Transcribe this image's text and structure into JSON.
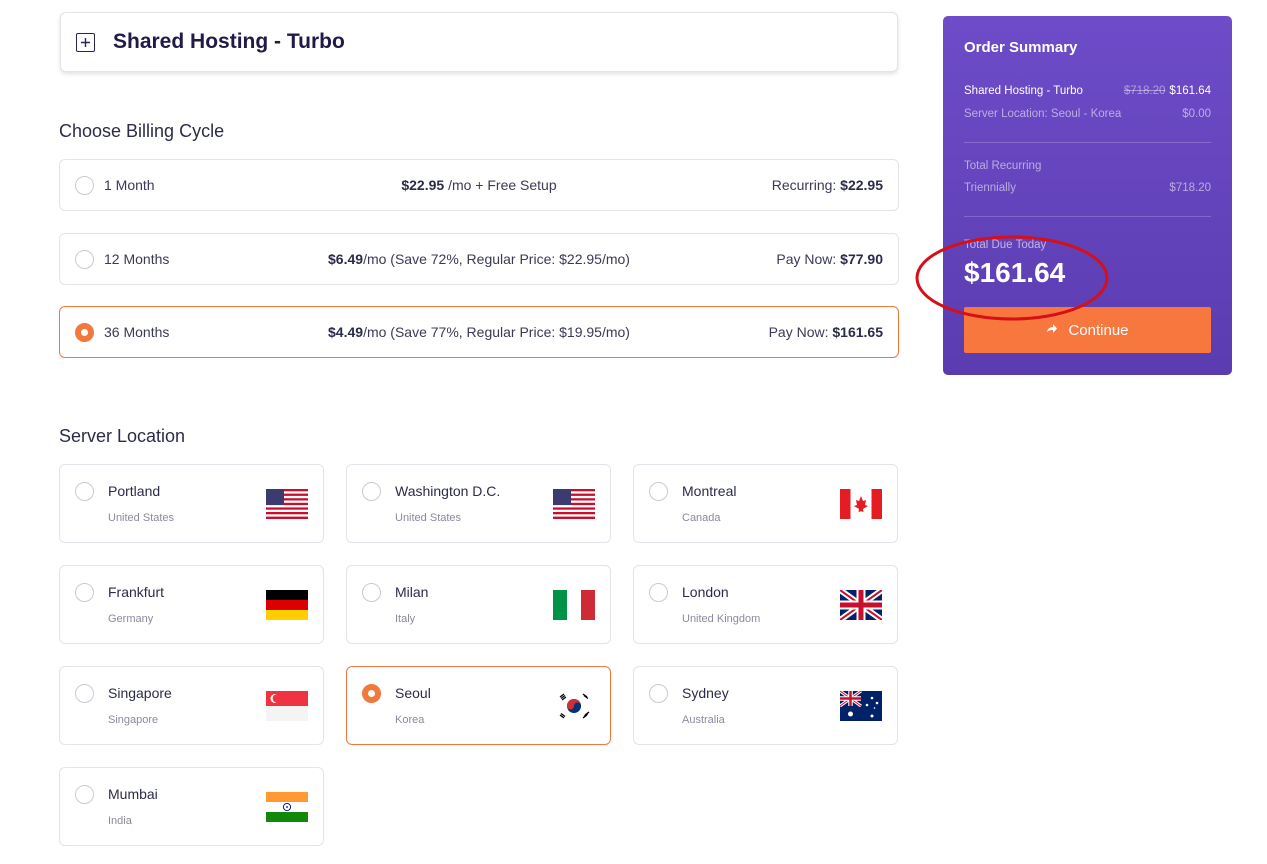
{
  "product": {
    "title": "Shared Hosting - Turbo"
  },
  "billing": {
    "title": "Choose Billing Cycle",
    "options": [
      {
        "label": "1 Month",
        "price": "$22.95",
        "price_suffix": " /mo + Free Setup",
        "right_label": "Recurring: ",
        "right_value": "$22.95",
        "selected": false
      },
      {
        "label": "12 Months",
        "price": "$6.49",
        "price_suffix": "/mo (Save 72%, Regular Price: $22.95/mo)",
        "right_label": "Pay Now: ",
        "right_value": "$77.90",
        "selected": false
      },
      {
        "label": "36 Months",
        "price": "$4.49",
        "price_suffix": "/mo (Save 77%, Regular Price: $19.95/mo)",
        "right_label": "Pay Now: ",
        "right_value": "$161.65",
        "selected": true
      }
    ]
  },
  "location": {
    "title": "Server Location",
    "items": [
      {
        "city": "Portland",
        "country": "United States",
        "flag": "us-flag-icon",
        "selected": false
      },
      {
        "city": "Washington D.C.",
        "country": "United States",
        "flag": "us-flag-icon",
        "selected": false
      },
      {
        "city": "Montreal",
        "country": "Canada",
        "flag": "canada-flag-icon",
        "selected": false
      },
      {
        "city": "Frankfurt",
        "country": "Germany",
        "flag": "germany-flag-icon",
        "selected": false
      },
      {
        "city": "Milan",
        "country": "Italy",
        "flag": "italy-flag-icon",
        "selected": false
      },
      {
        "city": "London",
        "country": "United Kingdom",
        "flag": "uk-flag-icon",
        "selected": false
      },
      {
        "city": "Singapore",
        "country": "Singapore",
        "flag": "singapore-flag-icon",
        "selected": false
      },
      {
        "city": "Seoul",
        "country": "Korea",
        "flag": "korea-flag-icon",
        "selected": true
      },
      {
        "city": "Sydney",
        "country": "Australia",
        "flag": "australia-flag-icon",
        "selected": false
      },
      {
        "city": "Mumbai",
        "country": "India",
        "flag": "india-flag-icon",
        "selected": false
      }
    ]
  },
  "summary": {
    "title": "Order Summary",
    "product_name": "Shared Hosting - Turbo",
    "product_old_price": "$718.20",
    "product_price": "$161.64",
    "location_line": "Server Location: Seoul - Korea",
    "location_price": "$0.00",
    "recurring_label": "Total Recurring",
    "recurring_period": "Triennially",
    "recurring_price": "$718.20",
    "due_label": "Total Due Today",
    "due_amount": "$161.64",
    "continue_label": "Continue"
  },
  "colors": {
    "accent": "#f2783d",
    "summary_bg": "#6347bd",
    "annotation": "#d60f18"
  }
}
